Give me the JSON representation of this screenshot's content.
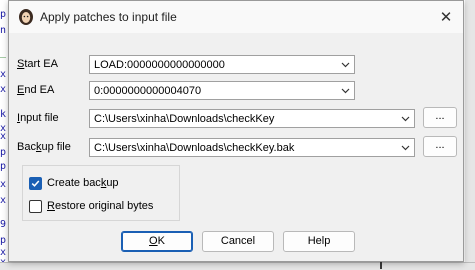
{
  "background": {
    "left_fragments": [
      "p",
      "n",
      "_",
      "x",
      "x",
      "k",
      "x",
      "x",
      "p",
      "p",
      "x",
      "x",
      "9",
      "p",
      "x",
      "x"
    ]
  },
  "dialog": {
    "title": "Apply patches to input file",
    "close_glyph": "✕"
  },
  "fields": {
    "start_ea": {
      "label_prefix": "S",
      "label_rest": "tart EA",
      "value": "LOAD:0000000000000000"
    },
    "end_ea": {
      "label_prefix": "E",
      "label_rest": "nd EA",
      "value": "0:0000000000004070"
    },
    "input_file": {
      "label_pre": "",
      "label_u": "I",
      "label_rest": "nput file",
      "value": "C:\\Users\\xinha\\Downloads\\checkKey"
    },
    "backup_file": {
      "label_pre": "Bac",
      "label_u": "k",
      "label_rest": "up file",
      "value": "C:\\Users\\xinha\\Downloads\\checkKey.bak"
    }
  },
  "browse_label": "...",
  "options": {
    "create_backup": {
      "label_pre": "Create bac",
      "label_u": "k",
      "label_rest": "up",
      "checked": true
    },
    "restore_bytes": {
      "label_pre": "",
      "label_u": "R",
      "label_rest": "estore original bytes",
      "checked": false
    }
  },
  "buttons": {
    "ok_u": "O",
    "ok_rest": "K",
    "cancel": "Cancel",
    "help": "Help"
  },
  "colors": {
    "accent": "#1a5fb4"
  }
}
